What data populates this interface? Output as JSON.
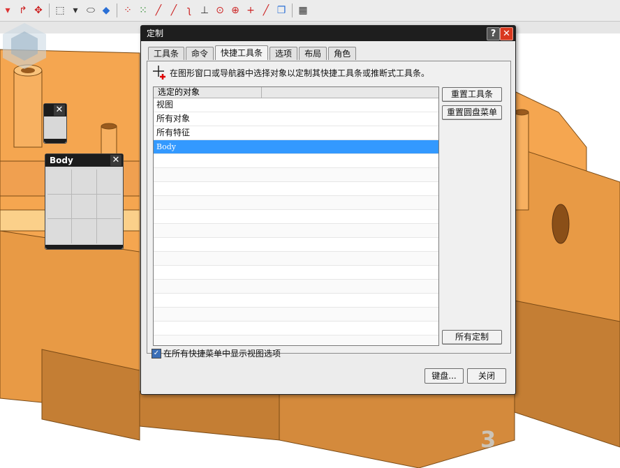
{
  "toolbar": {
    "icons": [
      "dropdown-arrow-icon",
      "rotate-arrow-icon",
      "measure-icon",
      "box-select-icon",
      "dropdown-arrow-icon",
      "eraser-icon",
      "cube-icon",
      "scatter-points-icon",
      "move-points-icon",
      "line-icon",
      "line-icon",
      "curve-icon",
      "point-icon",
      "target-icon",
      "crosshair-icon",
      "plus-icon",
      "diagonal-line-icon",
      "window-icon",
      "grid-icon"
    ]
  },
  "mini_panel_top": {
    "close": "✕"
  },
  "mini_panel_body": {
    "title": "Body",
    "close": "✕"
  },
  "dialog": {
    "title": "定制",
    "help": "?",
    "close": "✕",
    "tabs": [
      "工具条",
      "命令",
      "快捷工具条",
      "选项",
      "布局",
      "角色"
    ],
    "active_tab": "快捷工具条",
    "hint": "在图形窗口或导航器中选择对象以定制其快捷工具条或推断式工具条。",
    "list": {
      "header": "选定的对象",
      "rows": [
        "视图",
        "所有对象",
        "所有特征",
        "Body"
      ],
      "selected": "Body"
    },
    "buttons": {
      "reset_toolbar": "重置工具条",
      "reset_radial_menu": "重置圆盘菜单",
      "all_custom": "所有定制",
      "keyboard": "键盘...",
      "close_button": "关闭"
    },
    "checkbox": {
      "label": "在所有快捷菜单中显示视图选项",
      "checked": true
    }
  },
  "watermark": {
    "text": "3"
  },
  "colors": {
    "model_orange": "#f5a650",
    "model_shadow": "#b8742e",
    "selection_blue": "#3399ff",
    "title_bar": "#1e1e1e",
    "close_red": "#d9381e"
  }
}
